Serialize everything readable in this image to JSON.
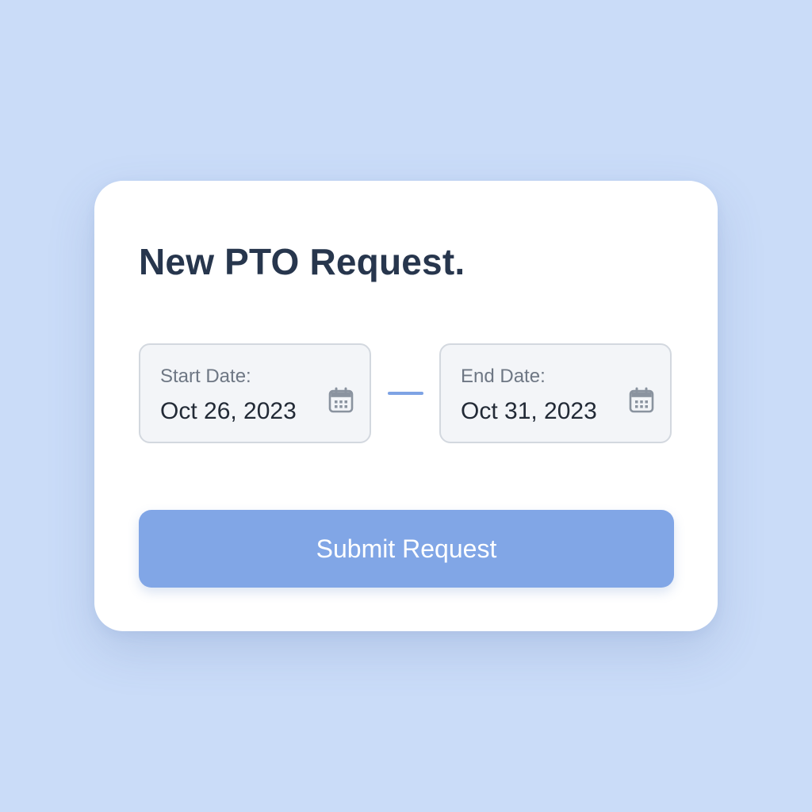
{
  "form": {
    "title": "New PTO Request.",
    "start_date": {
      "label": "Start Date:",
      "value": "Oct 26, 2023",
      "icon": "calendar-icon"
    },
    "end_date": {
      "label": "End Date:",
      "value": "Oct 31, 2023",
      "icon": "calendar-icon"
    },
    "submit_label": "Submit Request"
  },
  "colors": {
    "page_background": "#cadcf8",
    "card_background": "#ffffff",
    "title_text": "#27364d",
    "field_background": "#f3f5f8",
    "field_border": "#d3d8df",
    "accent": "#81a6e6",
    "icon": "#8a939f"
  }
}
